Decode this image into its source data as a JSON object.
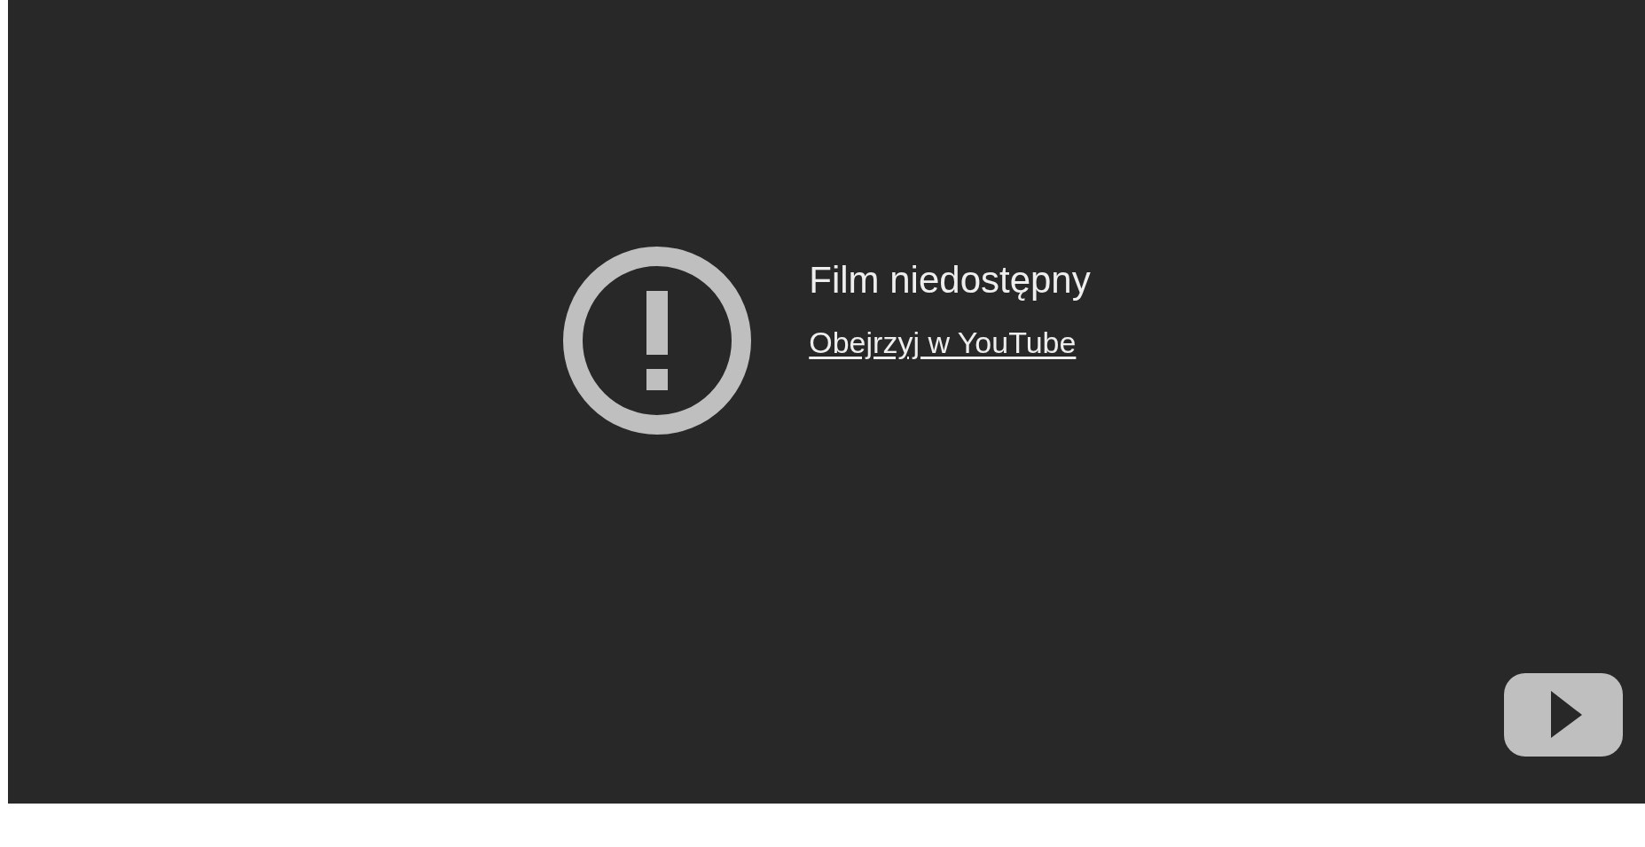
{
  "player": {
    "message": "Film niedostępny",
    "link": "Obejrzyj w YouTube"
  }
}
